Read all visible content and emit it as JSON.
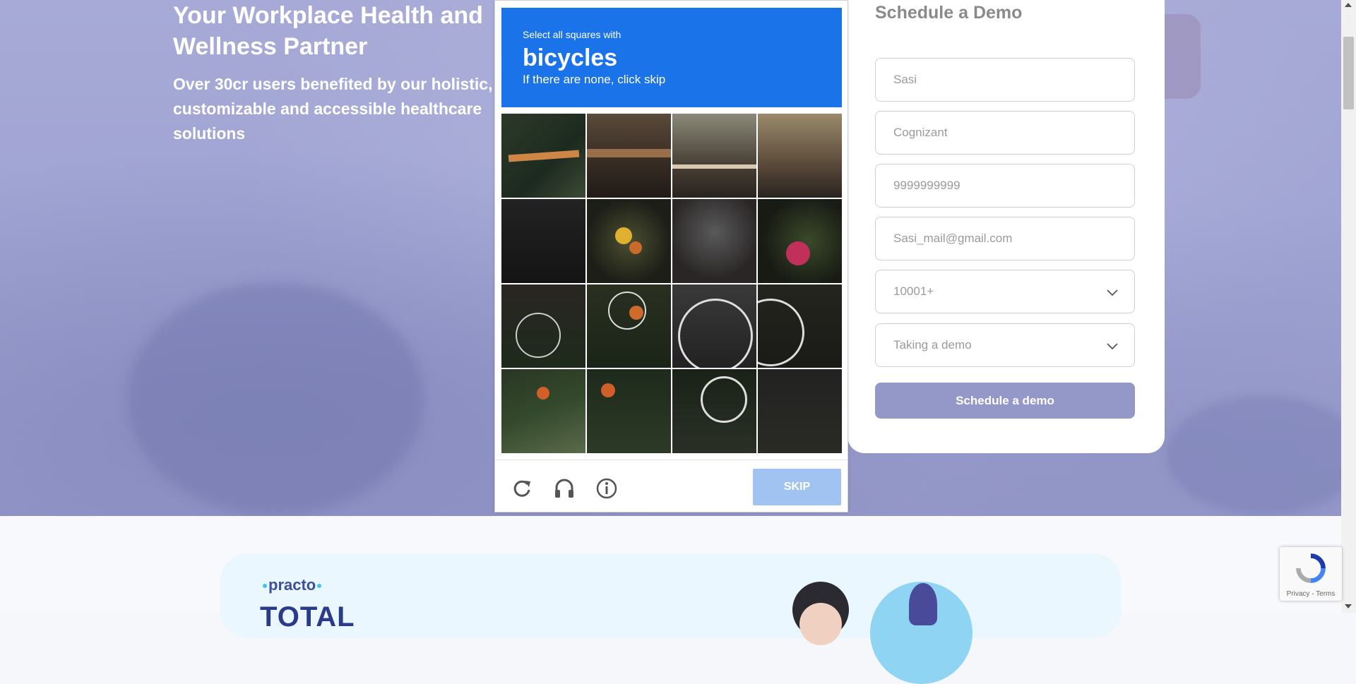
{
  "hero": {
    "title": "Your Workplace Health and Wellness Partner",
    "subtitle": "Over 30cr users benefited by our holistic, customizable and accessible healthcare solutions"
  },
  "form": {
    "title": "Schedule a Demo",
    "fields": [
      {
        "name": "name",
        "value": "Sasi"
      },
      {
        "name": "company",
        "value": "Cognizant"
      },
      {
        "name": "phone",
        "value": "9999999999"
      },
      {
        "name": "email",
        "value": "Sasi_mail@gmail.com"
      },
      {
        "name": "employee-count",
        "value": "10001+",
        "type": "select"
      },
      {
        "name": "interest",
        "value": "Taking a demo",
        "type": "select"
      }
    ],
    "submit_label": "Schedule a demo"
  },
  "captcha": {
    "line1": "Select all squares with",
    "keyword": "bicycles",
    "line3": "If there are none, click skip",
    "skip_label": "SKIP",
    "icons": [
      "reload-icon",
      "headphones-icon",
      "info-icon"
    ]
  },
  "promo": {
    "logo": "practo",
    "heading": "TOTAL"
  },
  "recaptcha_badge": {
    "terms": "Privacy - Terms"
  },
  "colors": {
    "captcha_blue": "#1a73e8",
    "skip_disabled": "#a1c3f1",
    "submit": "#9498c8",
    "hero_bg": "#a2a5d3"
  }
}
